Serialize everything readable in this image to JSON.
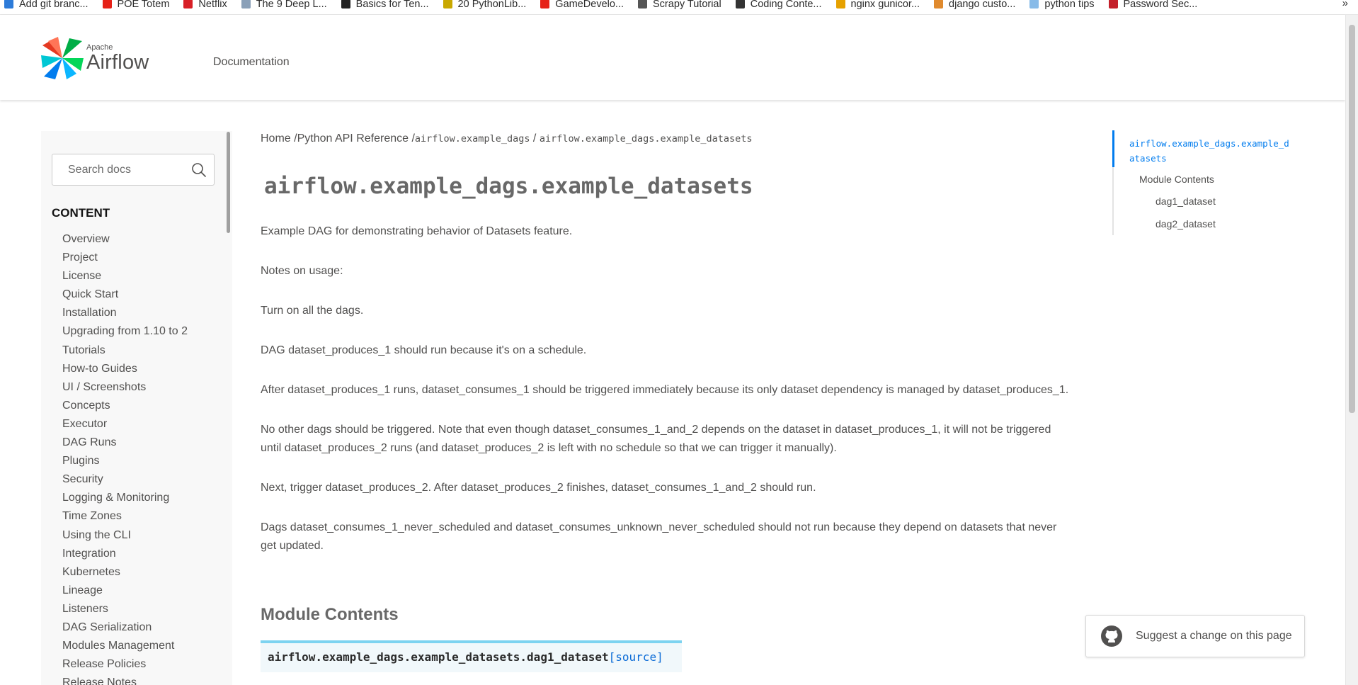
{
  "bookmarks": [
    {
      "label": "Add git branc...",
      "color": "#2d7bd9"
    },
    {
      "label": "POE Totem",
      "color": "#e62117"
    },
    {
      "label": "Netflix",
      "color": "#d81f26"
    },
    {
      "label": "The 9 Deep L...",
      "color": "#8aa0b8"
    },
    {
      "label": "Basics for Ten...",
      "color": "#222222"
    },
    {
      "label": "20 PythonLib...",
      "color": "#c9a800"
    },
    {
      "label": "GameDevelo...",
      "color": "#e62117"
    },
    {
      "label": "Scrapy Tutorial",
      "color": "#555555"
    },
    {
      "label": "Coding Conte...",
      "color": "#333333"
    },
    {
      "label": "nginx gunicor...",
      "color": "#e6a100"
    },
    {
      "label": "django custo...",
      "color": "#e08a2e"
    },
    {
      "label": "python tips",
      "color": "#88bbe8"
    },
    {
      "label": "Password Sec...",
      "color": "#c4202a"
    }
  ],
  "bookmarks_more": "»",
  "header": {
    "logo_small": "Apache",
    "logo_big": "Airflow",
    "nav_documentation": "Documentation"
  },
  "sidebar": {
    "search_placeholder": "Search docs",
    "content_title": "CONTENT",
    "items": [
      "Overview",
      "Project",
      "License",
      "Quick Start",
      "Installation",
      "Upgrading from 1.10 to 2",
      "Tutorials",
      "How-to Guides",
      "UI / Screenshots",
      "Concepts",
      "Executor",
      "DAG Runs",
      "Plugins",
      "Security",
      "Logging & Monitoring",
      "Time Zones",
      "Using the CLI",
      "Integration",
      "Kubernetes",
      "Lineage",
      "Listeners",
      "DAG Serialization",
      "Modules Management",
      "Release Policies",
      "Release Notes"
    ]
  },
  "breadcrumb": {
    "home": "Home",
    "sep1": " /",
    "api": "Python API Reference",
    "sep2": " /",
    "pkg": "airflow.example_dags",
    "sep3": " / ",
    "current": "airflow.example_dags.example_datasets"
  },
  "main": {
    "title": "airflow.example_dags.example_datasets",
    "paragraphs": [
      "Example DAG for demonstrating behavior of Datasets feature.",
      "Notes on usage:",
      "Turn on all the dags.",
      "DAG dataset_produces_1 should run because it's on a schedule.",
      "After dataset_produces_1 runs, dataset_consumes_1 should be triggered immediately because its only dataset dependency is managed by dataset_produces_1.",
      "No other dags should be triggered. Note that even though dataset_consumes_1_and_2 depends on the dataset in dataset_produces_1, it will not be triggered until dataset_produces_2 runs (and dataset_produces_2 is left with no schedule so that we can trigger it manually).",
      "Next, trigger dataset_produces_2. After dataset_produces_2 finishes, dataset_consumes_1_and_2 should run.",
      "Dags dataset_consumes_1_never_scheduled and dataset_consumes_unknown_never_scheduled should not run because they depend on datasets that never get updated."
    ],
    "module_contents_heading": "Module Contents",
    "signature_name": "airflow.example_dags.example_datasets.dag1_dataset",
    "signature_source": "[source]"
  },
  "toc": {
    "active": "airflow.example_dags.example_datasets",
    "module_contents": "Module Contents",
    "item1": "dag1_dataset",
    "item2": "dag2_dataset"
  },
  "suggest_button": "Suggest a change on this page",
  "colors": {
    "accent": "#017cee",
    "text": "#51504f",
    "signature_border": "#7dd3f0"
  }
}
